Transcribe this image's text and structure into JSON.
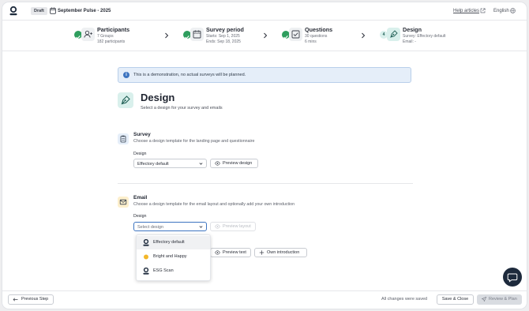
{
  "header": {
    "status_badge": "Draft",
    "survey_name": "September Pulse - 2025",
    "help_link": "Help articles",
    "language": "English"
  },
  "steps": [
    {
      "title": "Participants",
      "line1": "7 Groups",
      "line2": "182 participants",
      "icon": "add-person-icon",
      "status": "complete"
    },
    {
      "title": "Survey period",
      "line1": "Starts: Sep 1, 2025",
      "line2": "Ends: Sep 18, 2025",
      "icon": "calendar-icon",
      "status": "complete"
    },
    {
      "title": "Questions",
      "line1": "30 questions",
      "line2": "6 mins",
      "icon": "checklist-icon",
      "status": "complete"
    },
    {
      "title": "Design",
      "line1": "Survey: Effectory default",
      "line2": "Email: -",
      "icon": "pen-tool-icon",
      "step_number": "4",
      "status": "current"
    }
  ],
  "notice": "This is a demonstration, no actual surveys will be planned.",
  "page": {
    "title": "Design",
    "subtitle": "Select a design for your survey and emails"
  },
  "survey_section": {
    "title": "Survey",
    "description": "Choose a design template for the landing page and questionnaire",
    "field_label": "Design",
    "selected": "Effectory default",
    "preview_button": "Preview design"
  },
  "email_section": {
    "title": "Email",
    "description": "Choose a design template for the email layout and optionally add your own introduction",
    "field_label": "Design",
    "placeholder": "Select design",
    "preview_layout_button": "Preview layout",
    "preview_text_button": "Preview text",
    "own_intro_button": "Own introduction",
    "options": [
      "Effectory default",
      "Bright and Happy",
      "ESG Scan"
    ]
  },
  "footer": {
    "previous_button": "Previous Step",
    "saved_status": "All changes were saved",
    "save_close_button": "Save & Close",
    "review_button": "Review & Plan"
  },
  "colors": {
    "success": "#2f9e5e",
    "info": "#3d74c0",
    "design_accent": "#d9f0ec",
    "email_accent": "#fdefcc",
    "dark": "#1d2a3c"
  }
}
